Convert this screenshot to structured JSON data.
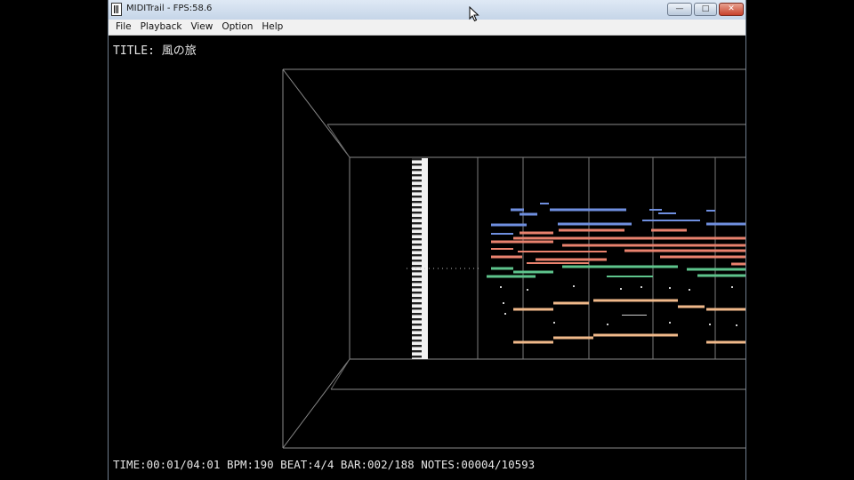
{
  "window": {
    "title": "MIDITrail - FPS:58.6",
    "minimize_glyph": "—",
    "maximize_glyph": "□",
    "close_glyph": "✕"
  },
  "menu": {
    "items": [
      "File",
      "Playback",
      "View",
      "Option",
      "Help"
    ]
  },
  "song": {
    "title_label": "TITLE: 風の旅"
  },
  "status": {
    "time": "TIME:00:01/04:01",
    "bpm": "BPM:190",
    "beat": "BEAT:4/4",
    "bar": "BAR:002/188",
    "notes": "NOTES:00004/10593"
  },
  "icons": {
    "app": "midi-trail-app-icon",
    "cursor": "mouse-pointer-icon"
  },
  "colors": {
    "background": "#000000",
    "note_blue": "#6f8fe0",
    "note_salmon": "#e9826e",
    "note_green": "#5ec48c",
    "note_peach": "#f0b98a",
    "grid_line": "#8a8a8a"
  }
}
